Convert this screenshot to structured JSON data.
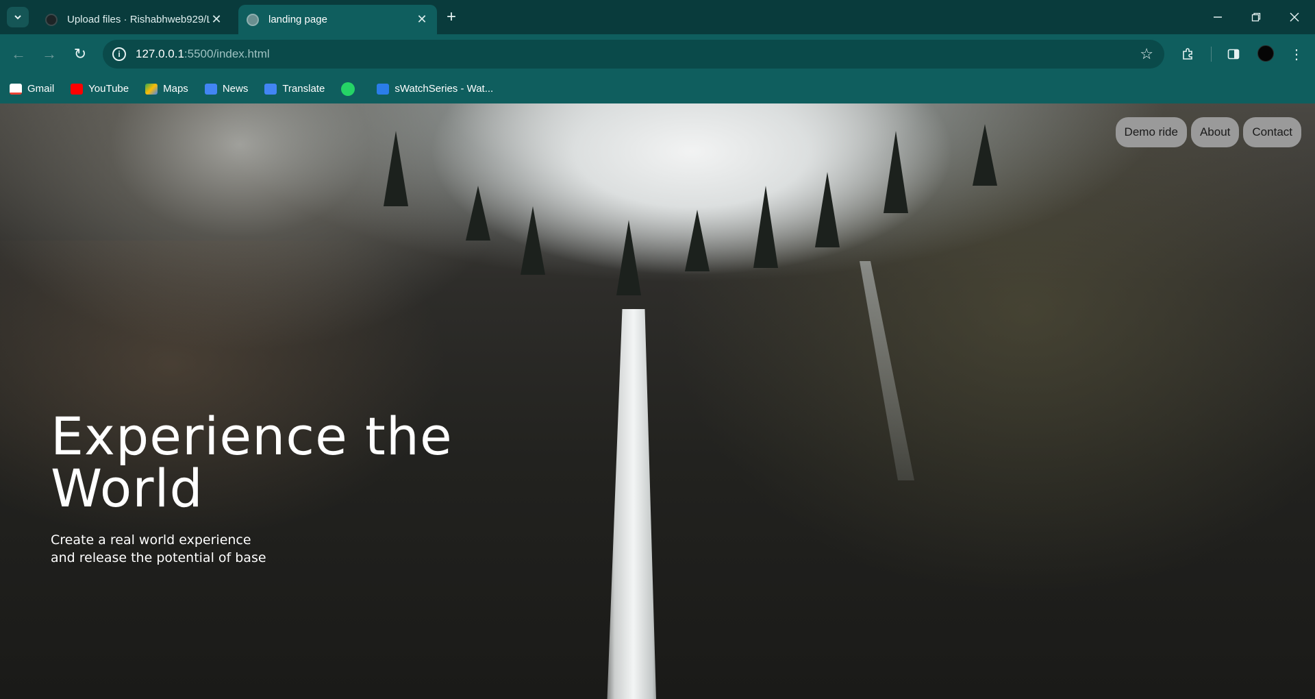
{
  "browser": {
    "tabs": [
      {
        "title": "Upload files · Rishabhweb929/L",
        "active": false
      },
      {
        "title": "landing page",
        "active": true
      }
    ],
    "url_host": "127.0.0.1",
    "url_rest": ":5500/index.html",
    "bookmarks": [
      {
        "label": "Gmail",
        "icon": "gmail-icon",
        "color": "#ea4335"
      },
      {
        "label": "YouTube",
        "icon": "youtube-icon",
        "color": "#ff0000"
      },
      {
        "label": "Maps",
        "icon": "maps-icon",
        "color": "#34a853"
      },
      {
        "label": "News",
        "icon": "news-icon",
        "color": "#4285f4"
      },
      {
        "label": "Translate",
        "icon": "translate-icon",
        "color": "#4285f4"
      },
      {
        "label": "",
        "icon": "whatsapp-icon",
        "color": "#25d366"
      },
      {
        "label": "sWatchSeries - Wat...",
        "icon": "swatchseries-icon",
        "color": "#2b7de9"
      }
    ],
    "theme": {
      "frame": "#093b3c",
      "toolbar": "#0f5e5e"
    }
  },
  "page": {
    "nav": {
      "demo_ride": "Demo ride",
      "about": "About",
      "contact": "Contact"
    },
    "hero": {
      "title": "Experience the World",
      "subtitle": "Create a real world experience and release the potential of base"
    }
  }
}
